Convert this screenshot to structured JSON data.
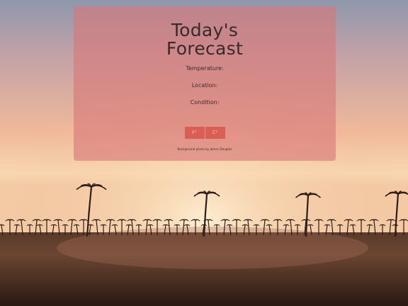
{
  "forecast": {
    "title_line1": "Today's",
    "title_line2": "Forecast",
    "temperature_label": "Temperature:",
    "location_label": "Location:",
    "condition_label": "Condition:"
  },
  "units": {
    "fahrenheit_label": "F°",
    "celsius_label": "C°"
  },
  "footer": {
    "credit": "Background photo by James Douglas"
  },
  "colors": {
    "card": "#d67878",
    "button": "#d95f54",
    "sky_top": "#9aa0b3",
    "sky_horizon": "#f3c9a0"
  }
}
